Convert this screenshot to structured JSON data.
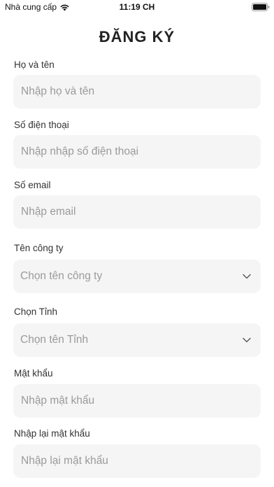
{
  "status_bar": {
    "carrier": "Nhà cung cấp",
    "time": "11:19 CH",
    "icons": [
      "wifi-icon",
      "battery-icon"
    ]
  },
  "page": {
    "title": "ĐĂNG KÝ"
  },
  "form": {
    "full_name": {
      "label": "Họ và tên",
      "placeholder": "Nhập họ và tên",
      "value": ""
    },
    "phone": {
      "label": "Số điện thoại",
      "placeholder": "Nhập nhập số điện thoại",
      "value": ""
    },
    "email": {
      "label": "Số email",
      "placeholder": "Nhập email",
      "value": ""
    },
    "company": {
      "label": "Tên công ty",
      "selected": "Chọn tên công ty",
      "icon": "chevron-down-icon"
    },
    "province": {
      "label": "Chọn Tỉnh",
      "selected": "Chọn tên Tỉnh",
      "icon": "chevron-down-icon"
    },
    "password": {
      "label": "Mật khẩu",
      "placeholder": "Nhập mật khẩu",
      "value": ""
    },
    "confirm_password": {
      "label": "Nhập lại mật khẩu",
      "placeholder": "Nhập lại mật khẩu",
      "value": ""
    }
  },
  "colors": {
    "field_background": "#f5f5f5",
    "placeholder": "#9a9a9a",
    "text": "#222222"
  }
}
